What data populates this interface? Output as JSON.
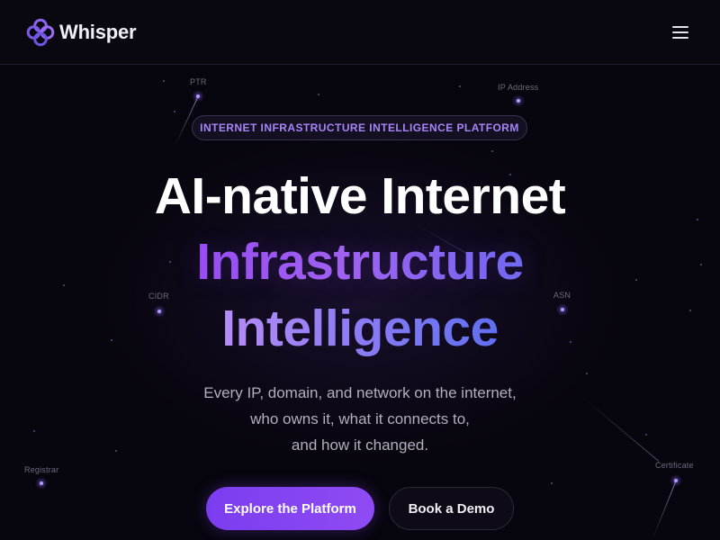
{
  "header": {
    "brand": "Whisper",
    "logo_icon": "whisper-logo-icon",
    "menu_icon": "hamburger-menu-icon"
  },
  "background_labels": {
    "ptr": "PTR",
    "ip_address": "IP Address",
    "cidr": "CIDR",
    "asn": "ASN",
    "registrar": "Registrar",
    "certificate": "Certificate"
  },
  "hero": {
    "badge": "INTERNET INFRASTRUCTURE INTELLIGENCE PLATFORM",
    "headline_line1": "AI-native Internet",
    "headline_line2": "Infrastructure",
    "headline_line3": "Intelligence",
    "subtitle_line1": "Every IP, domain, and network on the internet,",
    "subtitle_line2": "who owns it, what it connects to,",
    "subtitle_line3": "and how it changed.",
    "primary_button": "Explore the Platform",
    "secondary_button": "Book a Demo"
  },
  "colors": {
    "background": "#07050d",
    "accent_purple": "#8b45f2",
    "gradient_start": "#9b4df2",
    "gradient_end": "#5f6ff0",
    "badge_text": "#a784f7"
  }
}
